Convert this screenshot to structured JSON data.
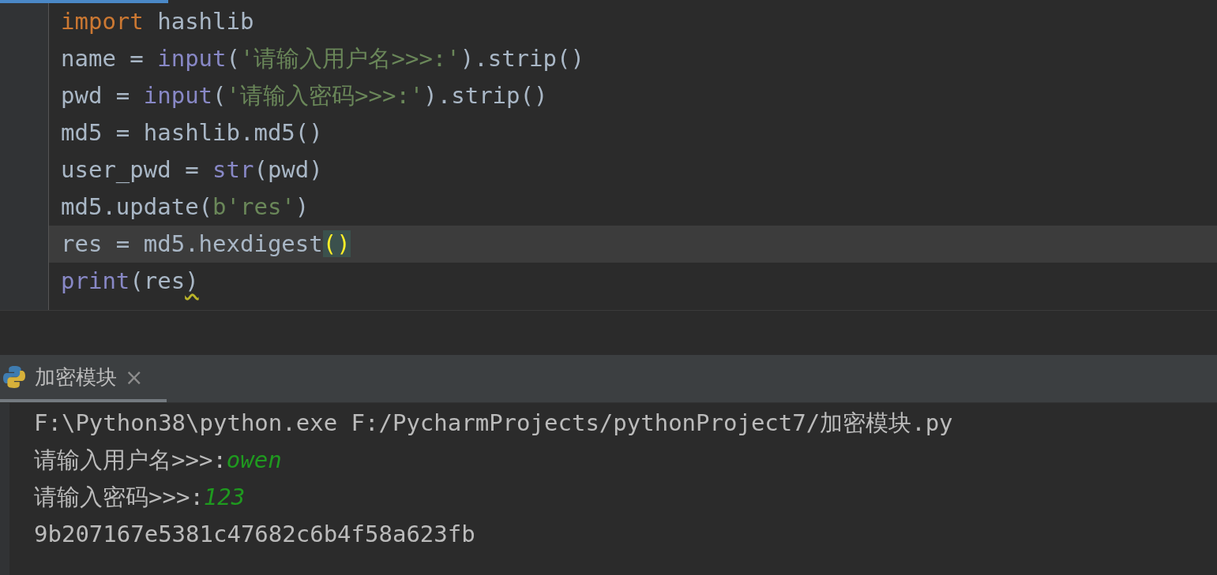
{
  "editor": {
    "lines": [
      {
        "current": false,
        "tokens": [
          {
            "kind": "keyword",
            "text": "import"
          },
          {
            "kind": "plain",
            "text": " hashlib"
          }
        ]
      },
      {
        "current": false,
        "tokens": [
          {
            "kind": "plain",
            "text": "name = "
          },
          {
            "kind": "builtin",
            "text": "input"
          },
          {
            "kind": "plain",
            "text": "("
          },
          {
            "kind": "string",
            "text": "'请输入用户名>>>:'"
          },
          {
            "kind": "plain",
            "text": ").strip()"
          }
        ]
      },
      {
        "current": false,
        "tokens": [
          {
            "kind": "plain",
            "text": "pwd = "
          },
          {
            "kind": "builtin",
            "text": "input"
          },
          {
            "kind": "plain",
            "text": "("
          },
          {
            "kind": "string",
            "text": "'请输入密码>>>:'"
          },
          {
            "kind": "plain",
            "text": ").strip()"
          }
        ]
      },
      {
        "current": false,
        "tokens": [
          {
            "kind": "plain",
            "text": "md5 = hashlib.md5()"
          }
        ]
      },
      {
        "current": false,
        "tokens": [
          {
            "kind": "plain",
            "text": "user_pwd = "
          },
          {
            "kind": "builtin",
            "text": "str"
          },
          {
            "kind": "plain",
            "text": "(pwd)"
          }
        ]
      },
      {
        "current": false,
        "tokens": [
          {
            "kind": "plain",
            "text": "md5.update("
          },
          {
            "kind": "string",
            "text": "b'res'"
          },
          {
            "kind": "plain",
            "text": ")"
          }
        ]
      },
      {
        "current": true,
        "tokens": [
          {
            "kind": "plain",
            "text": "res = md5.hexdigest"
          },
          {
            "kind": "brace-match",
            "text": "()"
          }
        ]
      },
      {
        "current": false,
        "tokens": [
          {
            "kind": "builtin",
            "text": "print"
          },
          {
            "kind": "plain",
            "text": "(res"
          },
          {
            "kind": "warning",
            "text": ")"
          }
        ]
      }
    ]
  },
  "run_panel": {
    "tab": {
      "label": "加密模块",
      "close": "×",
      "selected": true
    },
    "lines": [
      {
        "segments": [
          {
            "kind": "output",
            "text": "F:\\Python38\\python.exe F:/PycharmProjects/pythonProject7/加密模块.py"
          }
        ]
      },
      {
        "segments": [
          {
            "kind": "output",
            "text": "请输入用户名>>>:"
          },
          {
            "kind": "input",
            "text": "owen"
          }
        ]
      },
      {
        "segments": [
          {
            "kind": "output",
            "text": "请输入密码>>>:"
          },
          {
            "kind": "input",
            "text": "123"
          }
        ]
      },
      {
        "segments": [
          {
            "kind": "output",
            "text": "9b207167e5381c47682c6b4f58a623fb"
          }
        ]
      }
    ]
  }
}
